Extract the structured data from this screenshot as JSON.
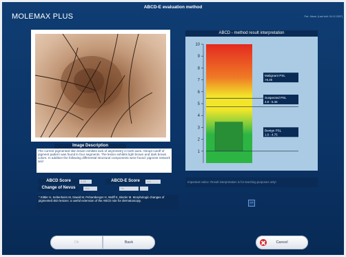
{
  "window": {
    "title": "ABCD-E evaluation method"
  },
  "brand": {
    "name": "MOLEMAX PLUS"
  },
  "patient_info": "Pat.: Neuer (Last visit: 04.12.2007)",
  "description": {
    "title": "Image Description",
    "text": "The current pigmented skin lesion exhibits lack of asymmetry in both axes. Abrupt cutoff of pigment pattern was found in four segments. The lesion exhibits light brown and dark brown colors. In addition the following differential structural components were found: pigment network and"
  },
  "scores": {
    "abcd_label": "ABCD Score",
    "abcd_value": "3.45",
    "abcde_label": "ABCD-E Score",
    "abcde_value": "n/a",
    "change_label": "Change of Nevus",
    "change_yes": "Yes",
    "change_no": "No"
  },
  "reference": "* Kittler H, Seltenheim M, Dawid M, Pehamberger H, Wolff K, Binder M. Morphologic changes of pigmented skin lesions: a useful extension of the ABCD rule for dermatoscopy.",
  "chart": {
    "title": "ABCD - method result interpretation",
    "ticks": [
      "1",
      "2",
      "3",
      "4",
      "5",
      "6",
      "7",
      "8",
      "9",
      "10"
    ],
    "zones": [
      {
        "label": "Malignant PSL",
        "range": ">5.45"
      },
      {
        "label": "Suspected PSL",
        "range": "4.8 - 5.45"
      },
      {
        "label": "Benign PSL",
        "range": "1.0 - 4.75"
      }
    ]
  },
  "chart_data": {
    "type": "bar",
    "ylim": [
      0,
      10
    ],
    "score": 3.45,
    "thresholds": [
      4.75,
      5.45
    ]
  },
  "notice": "Important notice: Result interpretation is for teaching purposes only!",
  "small_button_label": ">>",
  "buttons": {
    "ok": "Ok",
    "back": "Back",
    "cancel": "Cancel"
  },
  "colors": {
    "background": "#0b3467",
    "malignant": "#e42a20",
    "suspected": "#f3e62a",
    "benign": "#2db544",
    "cancel_icon": "#d8262b"
  }
}
